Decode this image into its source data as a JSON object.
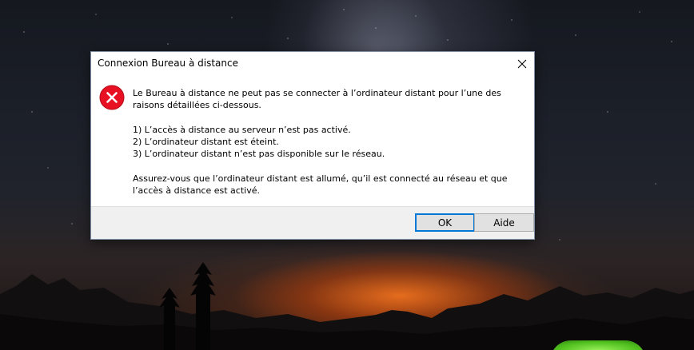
{
  "dialog": {
    "title": "Connexion Bureau à distance",
    "close_glyph": "✕",
    "icon": "error-icon",
    "message_intro": "Le Bureau à distance ne peut pas se connecter à l’ordinateur distant pour l’une des raisons détaillées ci-dessous.",
    "reasons": [
      "1) L’accès à distance au serveur n’est pas activé.",
      "2) L’ordinateur distant est éteint.",
      "3) L’ordinateur distant n’est pas disponible sur le réseau."
    ],
    "advice": "Assurez-vous que l’ordinateur distant est allumé, qu’il est connecté au réseau et que l’accès à distance est activé.",
    "buttons": {
      "ok": "OK",
      "help": "Aide"
    },
    "colors": {
      "error_red": "#e81123",
      "ok_focus": "#0078d7"
    }
  }
}
